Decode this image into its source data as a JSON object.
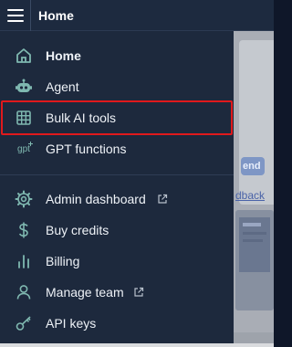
{
  "header": {
    "title": "Home",
    "menu_icon": "hamburger-icon"
  },
  "sidebar": {
    "items": [
      {
        "label": "Home",
        "icon": "home-icon",
        "bold": true
      },
      {
        "label": "Agent",
        "icon": "robot-icon"
      },
      {
        "label": "Bulk AI tools",
        "icon": "table-grid-icon",
        "highlighted": true
      },
      {
        "label": "GPT functions",
        "icon": "gpt-icon",
        "icon_text": "gpt"
      },
      {
        "label": "Admin dashboard",
        "icon": "gear-icon",
        "external": true
      },
      {
        "label": "Buy credits",
        "icon": "dollar-icon"
      },
      {
        "label": "Billing",
        "icon": "bar-chart-icon"
      },
      {
        "label": "Manage team",
        "icon": "user-icon",
        "external": true
      },
      {
        "label": "API keys",
        "icon": "key-icon"
      }
    ]
  },
  "background": {
    "button_fragment": "end",
    "link_fragment": "dback"
  },
  "colors": {
    "sidebar_bg": "#1d293d",
    "icon_color": "#7fb8b0",
    "highlight_border": "#e0191c",
    "text": "#eef2f7"
  }
}
